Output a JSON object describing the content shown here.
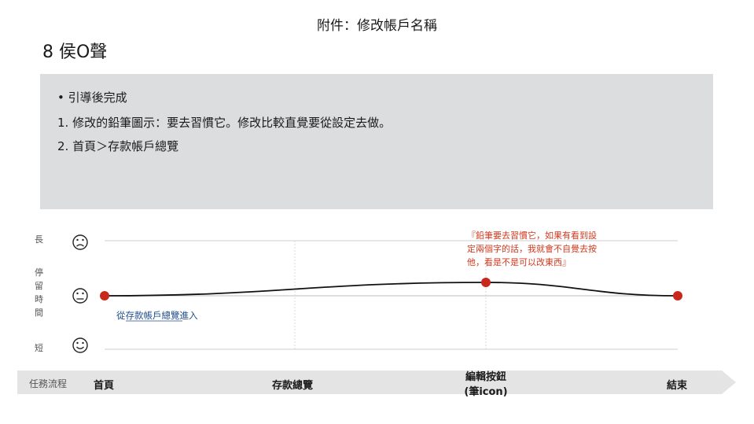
{
  "page_title": "附件：修改帳戶名稱",
  "participant": "8 侯O聲",
  "summary": {
    "bullet": "•  引導後完成",
    "line1": "1.  修改的鉛筆圖示：要去習慣它。修改比較直覺要從設定去做。",
    "line2": "2.  首頁＞存款帳戶總覽"
  },
  "chart_data": {
    "type": "line",
    "y_axis": {
      "long_label": "長",
      "mid_label": [
        "停",
        "留",
        "時",
        "間"
      ],
      "short_label": "短"
    },
    "faces": [
      "frown-icon",
      "neutral-icon",
      "smile-icon"
    ],
    "stages": [
      "首頁",
      "存款總覽",
      "編輯按鈕\n(筆icon)",
      "結束"
    ],
    "points": [
      {
        "stage": "首頁",
        "value": 0
      },
      {
        "stage": "編輯按鈕\n(筆icon)",
        "value": 0.25
      },
      {
        "stage": "結束",
        "value": 0
      }
    ],
    "annotations": [
      {
        "text": "從存款帳戶總覽進入",
        "color": "#1f4e8c"
      },
      {
        "lines": [
          "『鉛筆要去習慣它，如果有看到設",
          "定兩個字的話，我就會不自覺去按",
          "他，看是不是可以改東西』"
        ],
        "color": "#d13a1f"
      }
    ],
    "accent": "#c8281c"
  },
  "flow": {
    "label": "任務流程",
    "steps": [
      "首頁",
      "存款總覽",
      "編輯按鈕",
      "(筆icon)",
      "結束"
    ]
  }
}
